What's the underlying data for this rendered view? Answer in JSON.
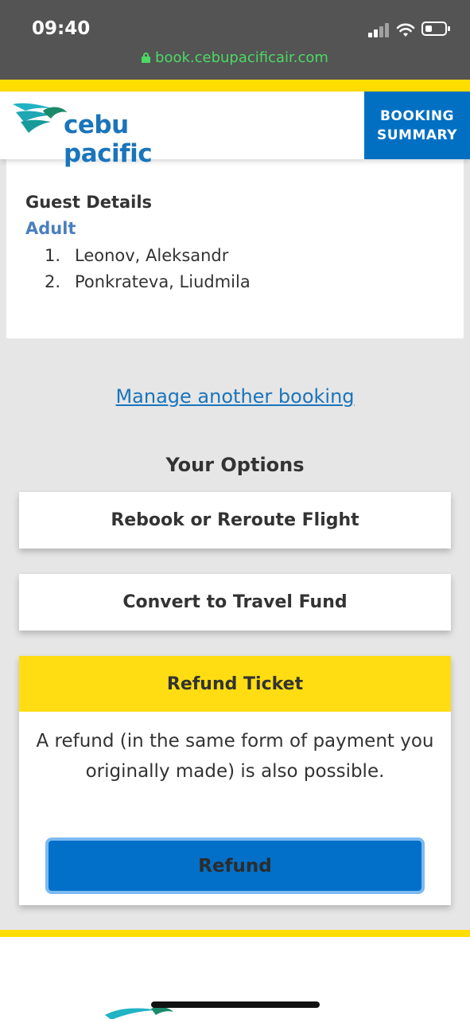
{
  "status_bar": {
    "time": "09:40",
    "url": "book.cebupacificair.com"
  },
  "header": {
    "logo_text": "cebu pacific",
    "booking_summary_line1": "BOOKING",
    "booking_summary_line2": "SUMMARY",
    "brand_blue": "#1a75bb",
    "brand_yellow": "#ffdd00"
  },
  "guest_details": {
    "title": "Guest Details",
    "type": "Adult",
    "guests": [
      {
        "num": "1.",
        "name": "Leonov, Aleksandr"
      },
      {
        "num": "2.",
        "name": "Ponkrateva, Liudmila"
      }
    ]
  },
  "manage_link": "Manage another booking",
  "options": {
    "title": "Your Options",
    "rebook_label": "Rebook or Reroute Flight",
    "convert_label": "Convert to Travel Fund",
    "refund": {
      "title": "Refund Ticket",
      "description": "A refund (in the same form of payment you originally made) is also possible.",
      "button_label": "Refund"
    }
  }
}
